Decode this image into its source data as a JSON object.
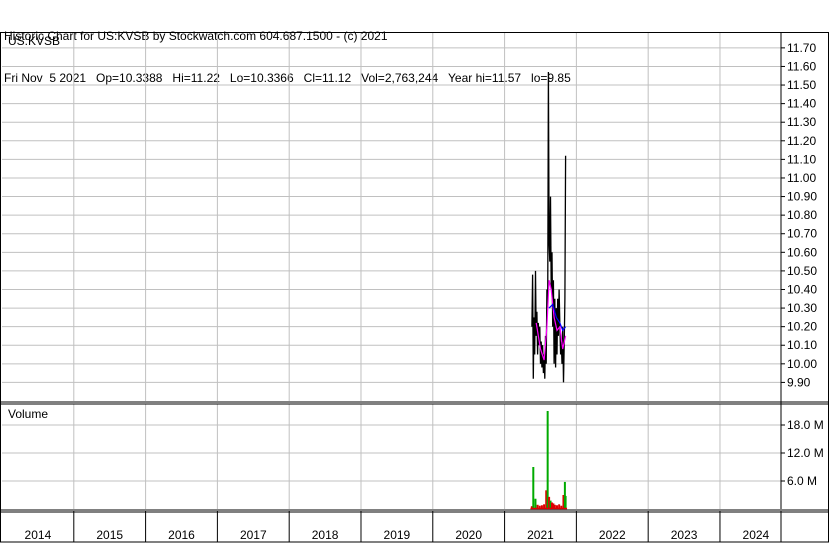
{
  "header": {
    "line1": "Historic Chart for US:KVSB by Stockwatch.com 604.687.1500 - (c) 2021",
    "line2": "Fri Nov  5 2021   Op=10.3388   Hi=11.22   Lo=10.3366   Cl=11.12   Vol=2,763,244   Year hi=11.57   lo=9.85"
  },
  "colors": {
    "price": "#000000",
    "moving_average_1": "#ff00ff",
    "moving_average_2": "#0000ff",
    "volume_up": "#00aa00",
    "volume_down": "#dd0000",
    "grid": "#c0c0c0"
  },
  "chart_data": [
    {
      "type": "line",
      "symbol": "US:KVSB",
      "y_ticks": [
        "11.70",
        "11.60",
        "11.50",
        "11.40",
        "11.30",
        "11.20",
        "11.10",
        "11.00",
        "10.90",
        "10.80",
        "10.70",
        "10.60",
        "10.50",
        "10.40",
        "10.30",
        "10.20",
        "10.10",
        "10.00",
        "9.90"
      ],
      "ylim": [
        9.8,
        11.78
      ],
      "x_ticks": [
        "2014",
        "2015",
        "2016",
        "2017",
        "2018",
        "2019",
        "2020",
        "2021",
        "2022",
        "2023",
        "2024"
      ],
      "x_range": [
        2013.5,
        2024.35
      ],
      "grid": true,
      "series": [
        {
          "values": [
            [
              2020.88,
              10.2
            ],
            [
              2020.89,
              10.48
            ],
            [
              2020.9,
              9.92
            ],
            [
              2020.91,
              10.25
            ],
            [
              2020.92,
              10.05
            ],
            [
              2020.93,
              10.5
            ],
            [
              2020.94,
              10.15
            ],
            [
              2020.95,
              10.28
            ],
            [
              2020.96,
              10.05
            ],
            [
              2020.97,
              10.22
            ],
            [
              2020.98,
              10.1
            ],
            [
              2020.99,
              10.2
            ],
            [
              2021.0,
              10.0
            ],
            [
              2021.01,
              10.12
            ],
            [
              2021.02,
              9.98
            ],
            [
              2021.03,
              10.1
            ],
            [
              2021.04,
              9.95
            ],
            [
              2021.05,
              10.05
            ],
            [
              2021.06,
              9.92
            ],
            [
              2021.07,
              10.15
            ],
            [
              2021.08,
              10.0
            ],
            [
              2021.09,
              10.4
            ],
            [
              2021.1,
              10.3
            ],
            [
              2021.11,
              11.57
            ],
            [
              2021.12,
              10.65
            ],
            [
              2021.13,
              10.55
            ],
            [
              2021.14,
              10.9
            ],
            [
              2021.15,
              10.4
            ],
            [
              2021.16,
              10.6
            ],
            [
              2021.17,
              10.2
            ],
            [
              2021.18,
              10.45
            ],
            [
              2021.19,
              10.0
            ],
            [
              2021.2,
              10.35
            ],
            [
              2021.21,
              9.98
            ],
            [
              2021.22,
              10.3
            ],
            [
              2021.23,
              10.05
            ],
            [
              2021.24,
              10.35
            ],
            [
              2021.25,
              10.15
            ],
            [
              2021.26,
              10.4
            ],
            [
              2021.27,
              10.2
            ],
            [
              2021.28,
              10.05
            ],
            [
              2021.29,
              10.12
            ],
            [
              2021.3,
              10.0
            ],
            [
              2021.31,
              10.2
            ],
            [
              2021.32,
              9.9
            ],
            [
              2021.33,
              10.1
            ],
            [
              2021.34,
              10.35
            ],
            [
              2021.35,
              11.12
            ]
          ]
        },
        {
          "name": "",
          "values": [
            [
              2020.94,
              10.22
            ],
            [
              2021.0,
              10.08
            ],
            [
              2021.05,
              10.02
            ],
            [
              2021.09,
              10.2
            ],
            [
              2021.12,
              10.45
            ],
            [
              2021.15,
              10.4
            ],
            [
              2021.19,
              10.25
            ],
            [
              2021.23,
              10.18
            ],
            [
              2021.27,
              10.2
            ],
            [
              2021.31,
              10.08
            ],
            [
              2021.35,
              10.15
            ]
          ]
        },
        {
          "name": "",
          "values": [
            [
              2021.12,
              10.3
            ],
            [
              2021.17,
              10.32
            ],
            [
              2021.22,
              10.25
            ],
            [
              2021.27,
              10.22
            ],
            [
              2021.31,
              10.18
            ],
            [
              2021.35,
              10.2
            ]
          ]
        }
      ]
    },
    {
      "type": "bar",
      "title": "Volume",
      "y_ticks": [
        "18.0 M",
        "12.0 M",
        "6.0 M"
      ],
      "ylim": [
        0,
        22.5
      ],
      "values": [
        [
          2020.88,
          0.6,
          "down"
        ],
        [
          2020.9,
          9.0,
          "up"
        ],
        [
          2020.93,
          2.2,
          "up"
        ],
        [
          2020.96,
          0.9,
          "down"
        ],
        [
          2020.99,
          0.7,
          "down"
        ],
        [
          2021.02,
          0.8,
          "down"
        ],
        [
          2021.05,
          1.0,
          "down"
        ],
        [
          2021.08,
          4.0,
          "down"
        ],
        [
          2021.1,
          21.0,
          "up"
        ],
        [
          2021.12,
          2.6,
          "down"
        ],
        [
          2021.14,
          1.8,
          "up"
        ],
        [
          2021.16,
          1.4,
          "down"
        ],
        [
          2021.18,
          1.2,
          "down"
        ],
        [
          2021.2,
          0.9,
          "down"
        ],
        [
          2021.23,
          0.8,
          "down"
        ],
        [
          2021.26,
          1.0,
          "down"
        ],
        [
          2021.29,
          0.7,
          "down"
        ],
        [
          2021.32,
          3.0,
          "down"
        ],
        [
          2021.34,
          5.8,
          "up"
        ],
        [
          2021.35,
          2.8,
          "up"
        ]
      ]
    }
  ]
}
